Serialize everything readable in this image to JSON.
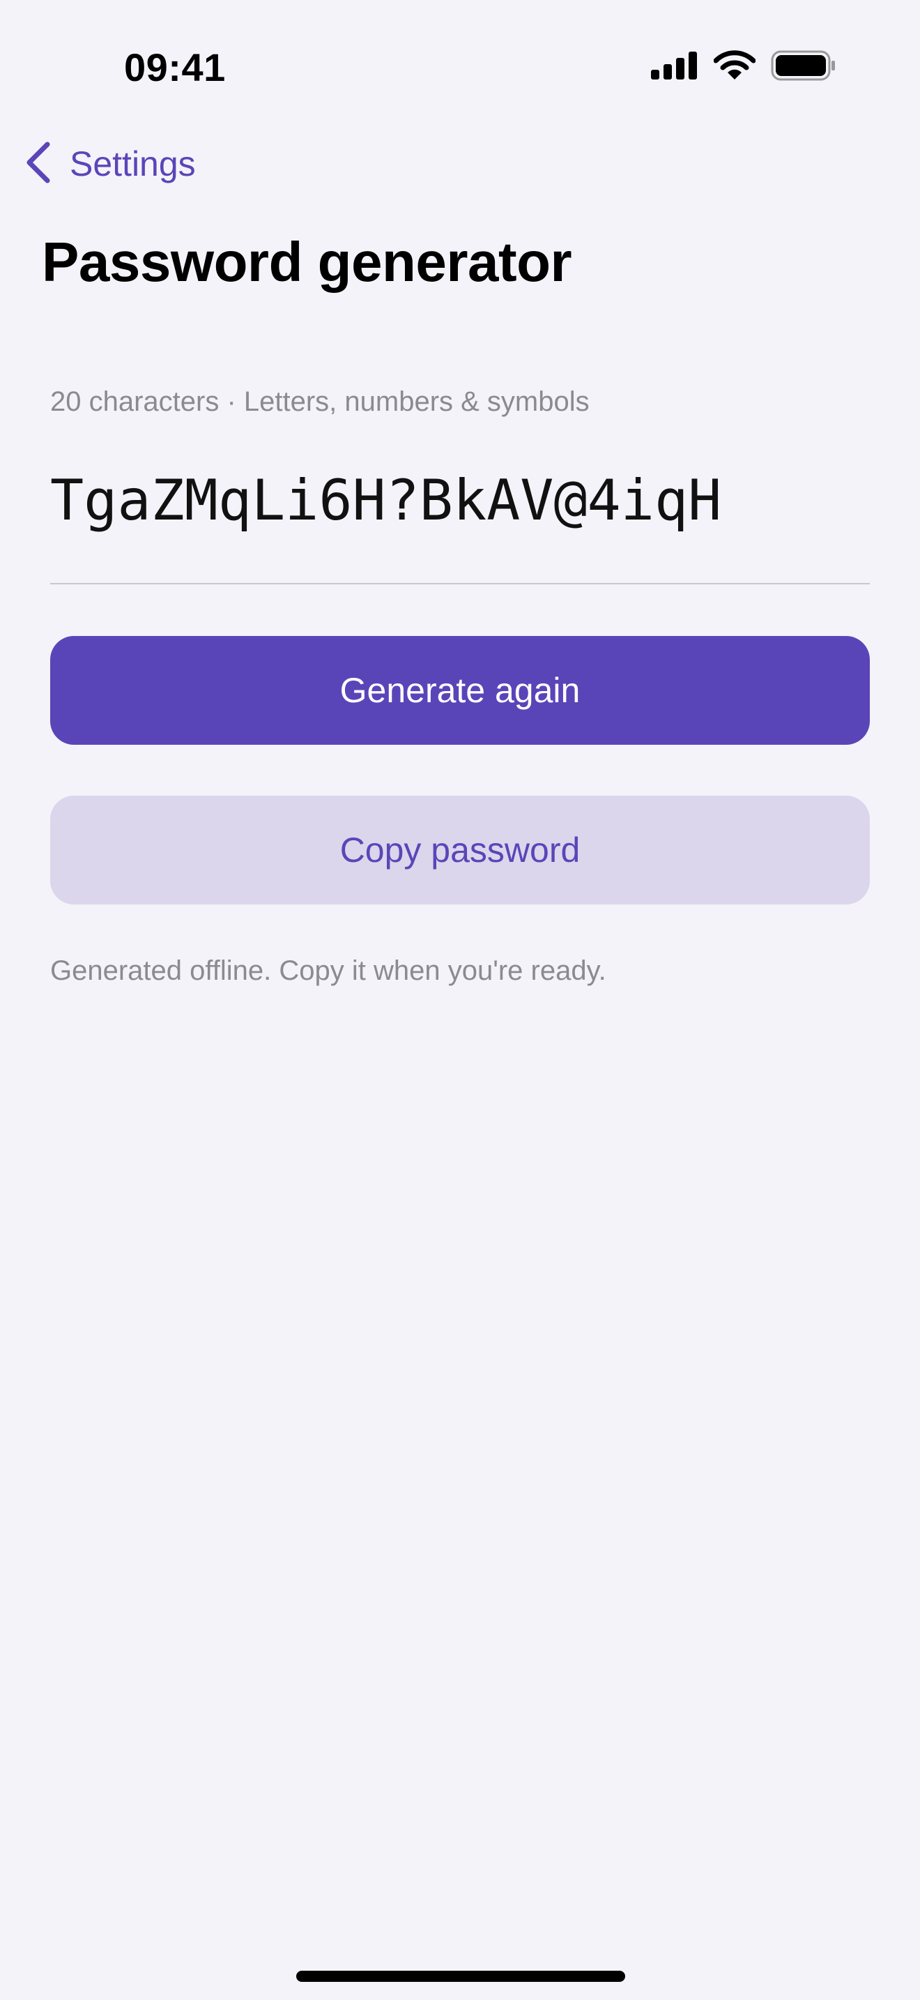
{
  "status_bar": {
    "time": "09:41",
    "icons": [
      "cellular-signal-icon",
      "wifi-icon",
      "battery-icon"
    ]
  },
  "nav": {
    "back_icon": "chevron-left-icon",
    "back_label": "Settings"
  },
  "page": {
    "title": "Password generator",
    "meta": "20 characters · Letters, numbers & symbols",
    "password": "TgaZMqLi6H?BkAV@4iqH",
    "footnote": "Generated offline. Copy it when you're ready."
  },
  "actions": {
    "generate_label": "Generate again",
    "copy_label": "Copy password"
  },
  "colors": {
    "accent": "#5a45b8",
    "accent_soft": "#dbd6ec",
    "background": "#f4f3f9",
    "secondary_text": "#8a8a90"
  }
}
